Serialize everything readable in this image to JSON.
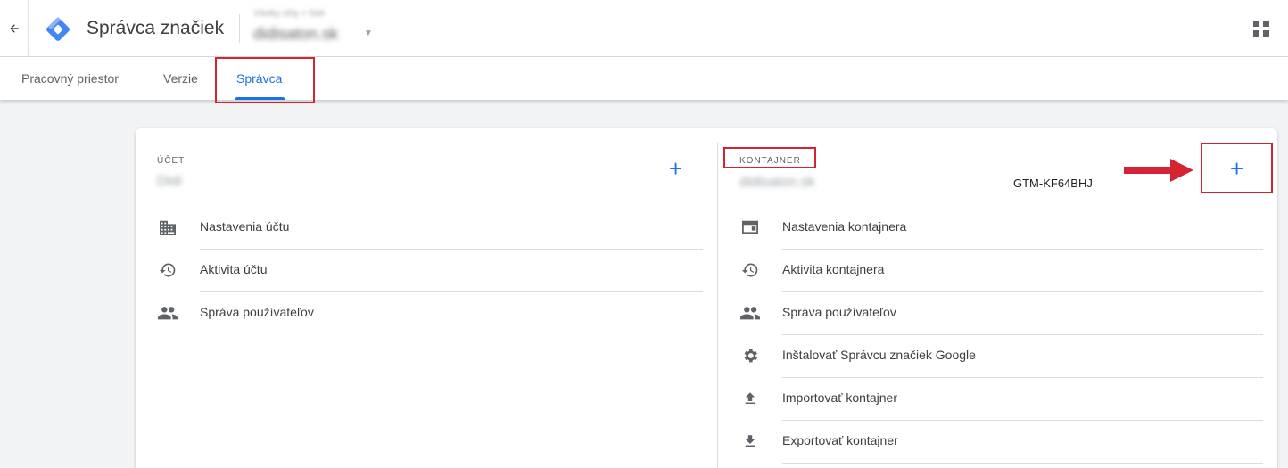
{
  "header": {
    "product_name": "Správca značiek",
    "breadcrumb": "Všetky účty > Didi",
    "container_name": "didisaton.sk"
  },
  "tabs": [
    {
      "label": "Pracovný priestor"
    },
    {
      "label": "Verzie"
    },
    {
      "label": "Správca"
    }
  ],
  "account": {
    "section_label": "ÚČET",
    "name": "Didi",
    "items": [
      {
        "label": "Nastavenia účtu",
        "icon": "building-icon"
      },
      {
        "label": "Aktivita účtu",
        "icon": "history-icon"
      },
      {
        "label": "Správa používateľov",
        "icon": "people-icon"
      }
    ]
  },
  "container": {
    "section_label": "KONTAJNER",
    "name": "didisaton.sk",
    "id": "GTM-KF64BHJ",
    "items": [
      {
        "label": "Nastavenia kontajnera",
        "icon": "web-window-icon"
      },
      {
        "label": "Aktivita kontajnera",
        "icon": "history-icon"
      },
      {
        "label": "Správa používateľov",
        "icon": "people-icon"
      },
      {
        "label": "Inštalovať Správcu značiek Google",
        "icon": "gear-icon"
      },
      {
        "label": "Importovať kontajner",
        "icon": "upload-icon"
      },
      {
        "label": "Exportovať kontajner",
        "icon": "download-icon"
      }
    ]
  },
  "colors": {
    "accent": "#1a73e8",
    "highlight": "#d42331"
  }
}
